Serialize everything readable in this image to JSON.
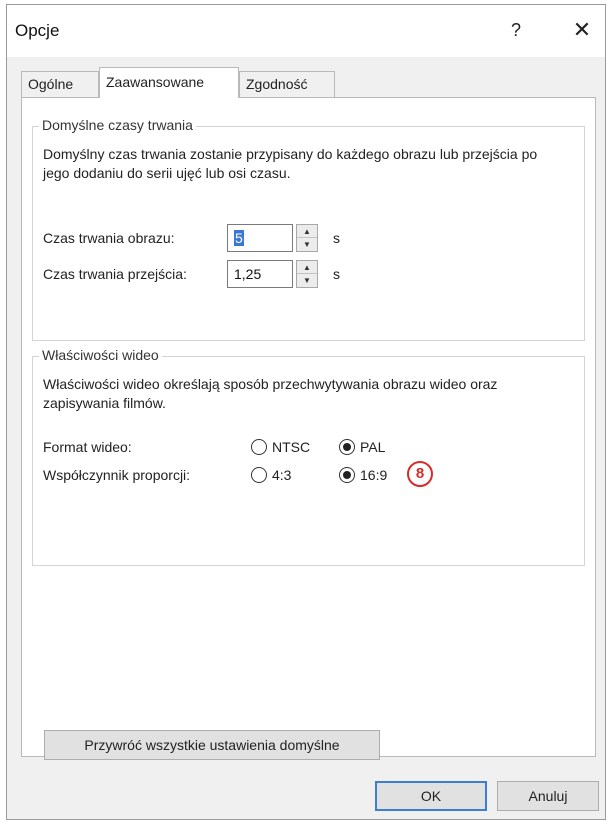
{
  "window": {
    "title": "Opcje",
    "help_label": "?",
    "close_label": "✕"
  },
  "tabs": [
    {
      "label": "Ogólne",
      "active": false
    },
    {
      "label": "Zaawansowane",
      "active": true
    },
    {
      "label": "Zgodność",
      "active": false
    }
  ],
  "durations": {
    "legend": "Domyślne czasy trwania",
    "description": "Domyślny czas trwania zostanie przypisany do każdego obrazu lub przejścia po jego dodaniu do serii ujęć lub osi czasu.",
    "image_label": "Czas trwania obrazu:",
    "image_value": "5",
    "transition_label": "Czas trwania przejścia:",
    "transition_value": "1,25",
    "unit": "s"
  },
  "video": {
    "legend": "Właściwości wideo",
    "description": "Właściwości wideo określają sposób przechwytywania obrazu wideo oraz zapisywania filmów.",
    "format_label": "Format wideo:",
    "format_options": [
      {
        "label": "NTSC",
        "checked": false
      },
      {
        "label": "PAL",
        "checked": true
      }
    ],
    "aspect_label": "Współczynnik proporcji:",
    "aspect_options": [
      {
        "label": "4:3",
        "checked": false
      },
      {
        "label": "16:9",
        "checked": true
      }
    ],
    "annotation": "8"
  },
  "buttons": {
    "restore": "Przywróć wszystkie ustawienia domyślne",
    "ok": "OK",
    "cancel": "Anuluj"
  },
  "colors": {
    "annotation": "#d92a2a",
    "selection": "#3a78d6",
    "default_button_border": "#3c7fd1"
  }
}
